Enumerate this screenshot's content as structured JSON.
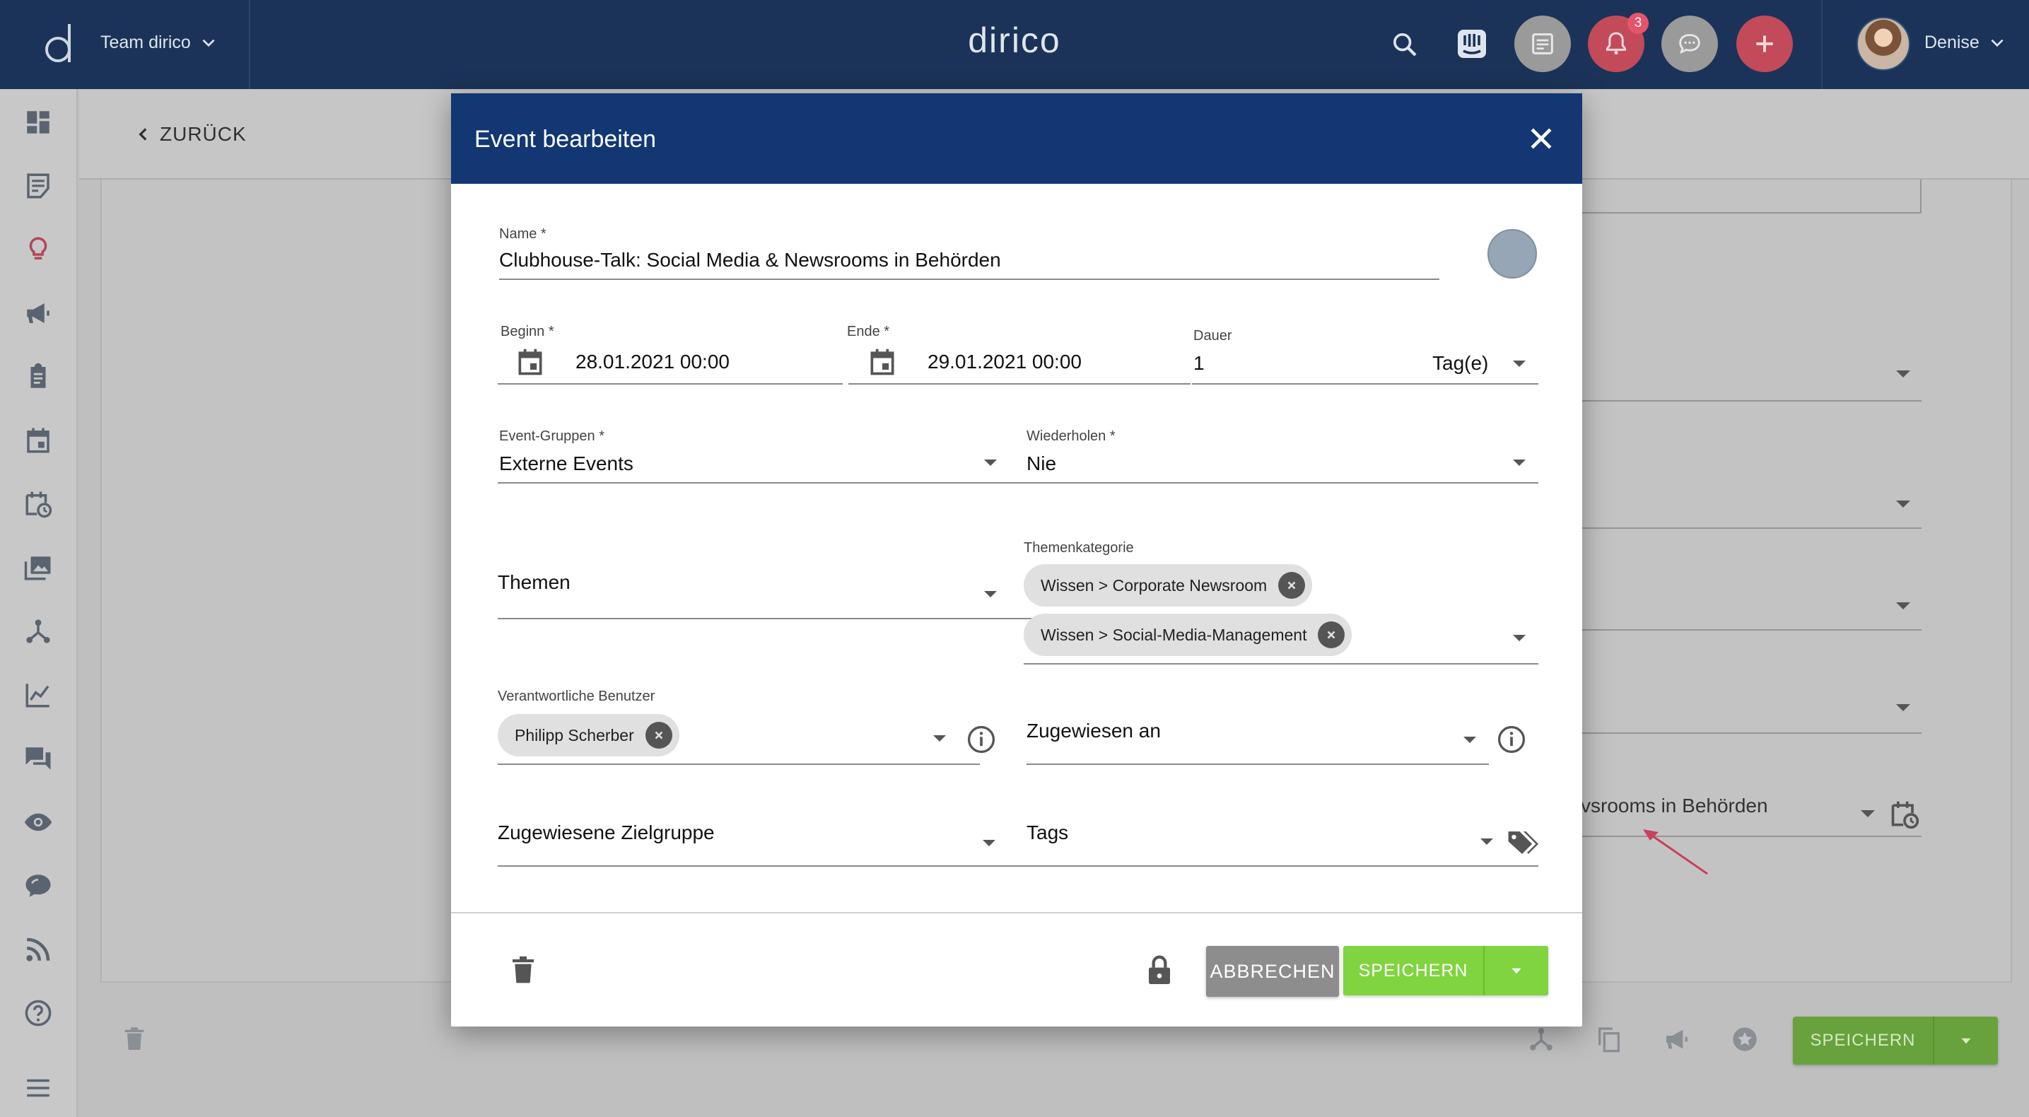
{
  "topbar": {
    "team_label": "Team dirico",
    "app_title": "dirico",
    "notification_count": "3",
    "user_name": "Denise"
  },
  "background_page": {
    "back_label": "ZURÜCK",
    "event_field_value": "vsrooms in Behörden",
    "save_label": "SPEICHERN"
  },
  "modal": {
    "title": "Event bearbeiten",
    "name": {
      "label": "Name *",
      "value": "Clubhouse-Talk: Social Media & Newsrooms in Behörden"
    },
    "begin": {
      "label": "Beginn *",
      "value": "28.01.2021 00:00"
    },
    "end": {
      "label": "Ende *",
      "value": "29.01.2021 00:00"
    },
    "duration": {
      "label": "Dauer",
      "value": "1",
      "unit": "Tag(e)"
    },
    "event_groups": {
      "label": "Event-Gruppen *",
      "value": "Externe Events"
    },
    "repeat": {
      "label": "Wiederholen *",
      "value": "Nie"
    },
    "topics": {
      "placeholder": "Themen"
    },
    "topic_category": {
      "label": "Themenkategorie",
      "chips": [
        "Wissen > Corporate Newsroom",
        "Wissen > Social-Media-Management"
      ]
    },
    "responsible_users": {
      "label": "Verantwortliche Benutzer",
      "chips": [
        "Philipp Scherber"
      ]
    },
    "assigned_to": {
      "placeholder": "Zugewiesen an"
    },
    "target_group": {
      "placeholder": "Zugewiesene Zielgruppe"
    },
    "tags": {
      "placeholder": "Tags"
    },
    "cancel_label": "ABBRECHEN",
    "save_label": "SPEICHERN"
  },
  "colors": {
    "topbar_bg": "#1b3358",
    "modal_header_bg": "#123773",
    "save_green": "#7fd43f",
    "notification_red": "#e8536b",
    "event_color": "#96a6b6"
  }
}
